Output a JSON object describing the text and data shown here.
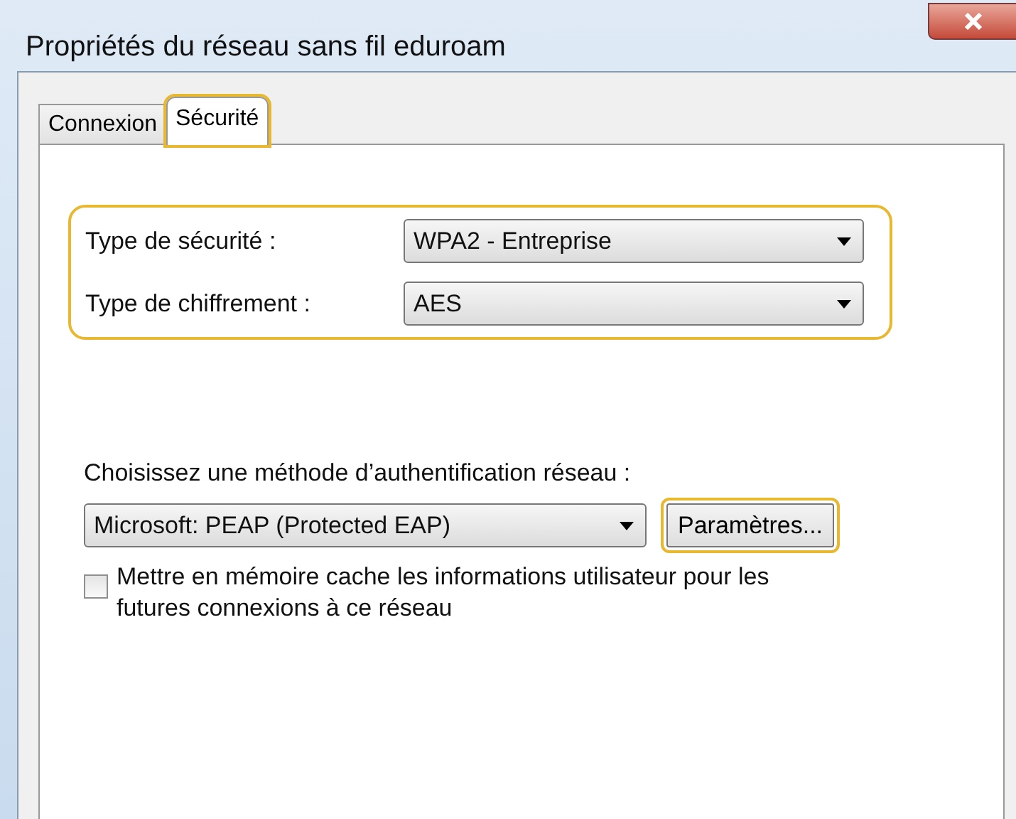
{
  "window": {
    "title": "Propriétés du réseau sans fil eduroam"
  },
  "tabs": [
    {
      "label": "Connexion",
      "selected": false,
      "highlighted": false
    },
    {
      "label": "Sécurité",
      "selected": true,
      "highlighted": true
    }
  ],
  "security_group": {
    "highlighted": true,
    "rows": [
      {
        "label": "Type de sécurité :",
        "value": "WPA2 - Entreprise"
      },
      {
        "label": "Type de chiffrement :",
        "value": "AES"
      }
    ]
  },
  "authentication": {
    "label": "Choisissez une méthode d’authentification réseau :",
    "value": "Microsoft: PEAP (Protected EAP)"
  },
  "settings_button": {
    "label": "Paramètres...",
    "highlighted": true
  },
  "remember_checkbox": {
    "label": "Mettre en mémoire cache les informations utilisateur pour les futures connexions à ce réseau",
    "checked": false
  }
}
